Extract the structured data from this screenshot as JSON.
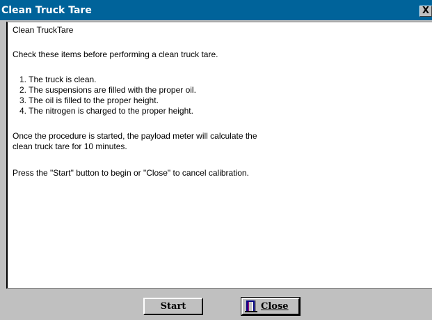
{
  "window": {
    "title": "Clean Truck Tare",
    "close_glyph": "X"
  },
  "content": {
    "lines": [
      "Clean TruckTare",
      "Check these items before performing a clean truck tare.",
      "1. The truck is clean.",
      "2. The suspensions are filled with the proper oil.",
      "3. The oil is filled to the proper height.",
      "4. The nitrogen is charged to the proper height.",
      "Once the procedure is started, the payload meter will calculate the",
      "clean truck tare for 10 minutes.",
      "Press the \"Start\" button to begin or \"Close\" to cancel calibration."
    ]
  },
  "buttons": {
    "start_label": "Start",
    "close_label": "Close",
    "close_icon": "door-icon"
  },
  "colors": {
    "titlebar": "#00639a",
    "face": "#c0c0c0"
  }
}
